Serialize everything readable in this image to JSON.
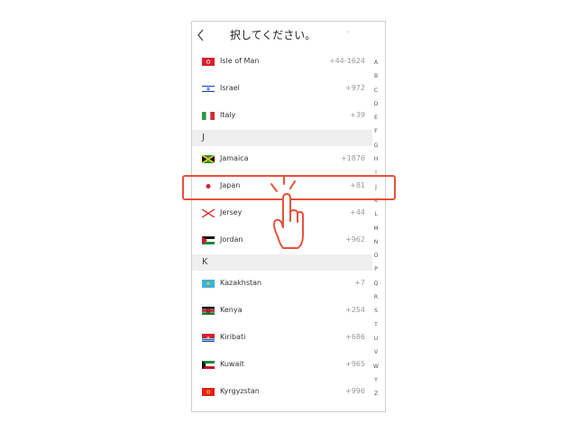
{
  "header": {
    "back_icon": "chevron-left-icon",
    "title": "択してください。",
    "dot": "·"
  },
  "groups": [
    {
      "letter": "",
      "items": [
        {
          "name": "Isle of Man",
          "code": "+44-1624",
          "flag": "isle-of-man"
        },
        {
          "name": "Israel",
          "code": "+972",
          "flag": "israel"
        },
        {
          "name": "Italy",
          "code": "+39",
          "flag": "italy"
        }
      ]
    },
    {
      "letter": "J",
      "items": [
        {
          "name": "Jamaica",
          "code": "+1876",
          "flag": "jamaica"
        },
        {
          "name": "Japan",
          "code": "+81",
          "flag": "japan"
        },
        {
          "name": "Jersey",
          "code": "+44",
          "flag": "jersey"
        },
        {
          "name": "Jordan",
          "code": "+962",
          "flag": "jordan"
        }
      ]
    },
    {
      "letter": "K",
      "items": [
        {
          "name": "Kazakhstan",
          "code": "+7",
          "flag": "kazakhstan"
        },
        {
          "name": "Kenya",
          "code": "+254",
          "flag": "kenya"
        },
        {
          "name": "Kiribati",
          "code": "+686",
          "flag": "kiribati"
        },
        {
          "name": "Kuwait",
          "code": "+965",
          "flag": "kuwait"
        },
        {
          "name": "Kyrgyzstan",
          "code": "+996",
          "flag": "kyrgyzstan"
        }
      ]
    }
  ],
  "index_letters": [
    "A",
    "B",
    "C",
    "D",
    "E",
    "F",
    "G",
    "H",
    "I",
    "J",
    "K",
    "L",
    "M",
    "N",
    "O",
    "P",
    "Q",
    "R",
    "S",
    "T",
    "U",
    "V",
    "W",
    "Y",
    "Z"
  ],
  "highlight": {
    "selected_country": "Japan",
    "gesture_icon": "tapping-hand-icon",
    "color": "#e8513a"
  }
}
